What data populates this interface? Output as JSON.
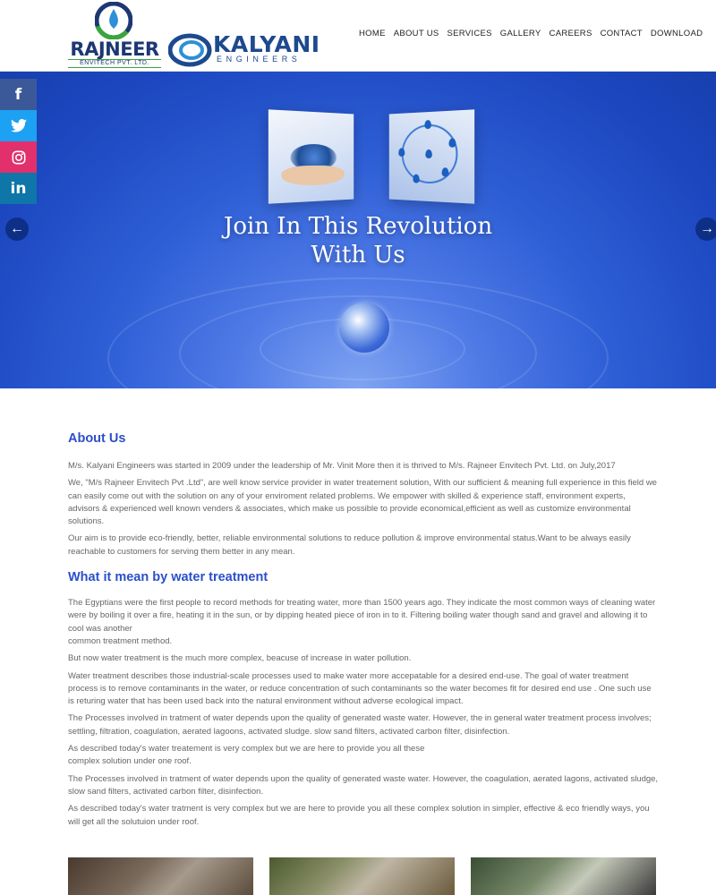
{
  "header": {
    "logo_rajneer": {
      "name": "RAJNEER",
      "sub": "ENVITECH PVT. LTD."
    },
    "logo_kalyani": {
      "name": "KALYANI",
      "sub": "ENGINEERS"
    },
    "nav": [
      "HOME",
      "ABOUT US",
      "SERVICES",
      "GALLERY",
      "CAREERS",
      "CONTACT",
      "DOWNLOAD"
    ]
  },
  "social": [
    {
      "icon": "facebook-icon",
      "glyph": "f",
      "color": "#3b5998"
    },
    {
      "icon": "twitter-icon",
      "glyph": "🐦",
      "color": "#1da1f2"
    },
    {
      "icon": "instagram-icon",
      "glyph": "◎",
      "color": "#e1306c"
    },
    {
      "icon": "linkedin-icon",
      "glyph": "in",
      "color": "#0e76a8"
    }
  ],
  "hero": {
    "title_line1": "Join In This Revolution",
    "title_line2": "With Us",
    "prev_glyph": "←",
    "next_glyph": "→"
  },
  "about": {
    "heading": "About Us",
    "paragraphs": [
      "M/s. Kalyani Engineers was started in 2009 under the leadership of Mr. Vinit More then it is thrived to M/s. Rajneer Envitech Pvt. Ltd. on July,2017",
      "We, \"M/s Rajneer Envitech Pvt .Ltd\", are well know service provider in water treatement solution, With our sufficient & meaning full experience in this field we can easily come out with the solution on any of your enviroment related problems. We empower with skilled & experience staff, environment experts, advisors & experienced well known venders & associates, which make us possible to provide economical,efficient as well as customize environmental solutions.",
      "Our aim is to provide eco-friendly, better, reliable environmental solutions to reduce pollution & improve environmental status.Want to be always easily reachable to customers for serving them better in any mean."
    ]
  },
  "treatment": {
    "heading": "What it mean by water treatment",
    "paragraphs": [
      "The Egyptians were the first people to record methods for treating water, more than 1500 years ago. They indicate the most common ways of cleaning water were by boiling it over a fire, heating it in the sun, or by dipping heated piece of iron in to it. Filtering boiling water though sand and gravel and allowing it to cool was another",
      "common treatment method.",
      "But now water treatment is the much more complex, beacuse of increase in water pollution.",
      "Water treatment describes those industrial-scale processes used to make water more accepatable for a desired end-use. The goal of water treatment process is to remove contaminants in the water, or reduce concentration of such contaminants so the water becomes fit for desired end use . One such use is returing water that has been used back into the natural environment without adverse ecological impact.",
      "The Processes involved in tratment of water depends upon the quality of generated waste water. However, the in general water treatment process involves; settling, filtration, coagulation, aerated lagoons, activated sludge. slow sand filters, activated carbon filter, disinfection.",
      "As described today's water treatement is very complex but we are here to provide you all these",
      "complex solution under one roof.",
      "The Processes involved in tratment of water depends upon the quality of generated waste water. However, the coagulation, aerated lagons, activated sludge, slow sand filters, activated carbon filter, disinfection.",
      "As described today's water tratment is very complex but we are here to provide you all these complex solution in simpler, effective & eco friendly ways, you will get all the solutuion under roof."
    ]
  },
  "colors": {
    "accent_heading": "#2b4fc9",
    "brand_navy": "#1c3773",
    "hero_blue": "#1c47c0"
  }
}
